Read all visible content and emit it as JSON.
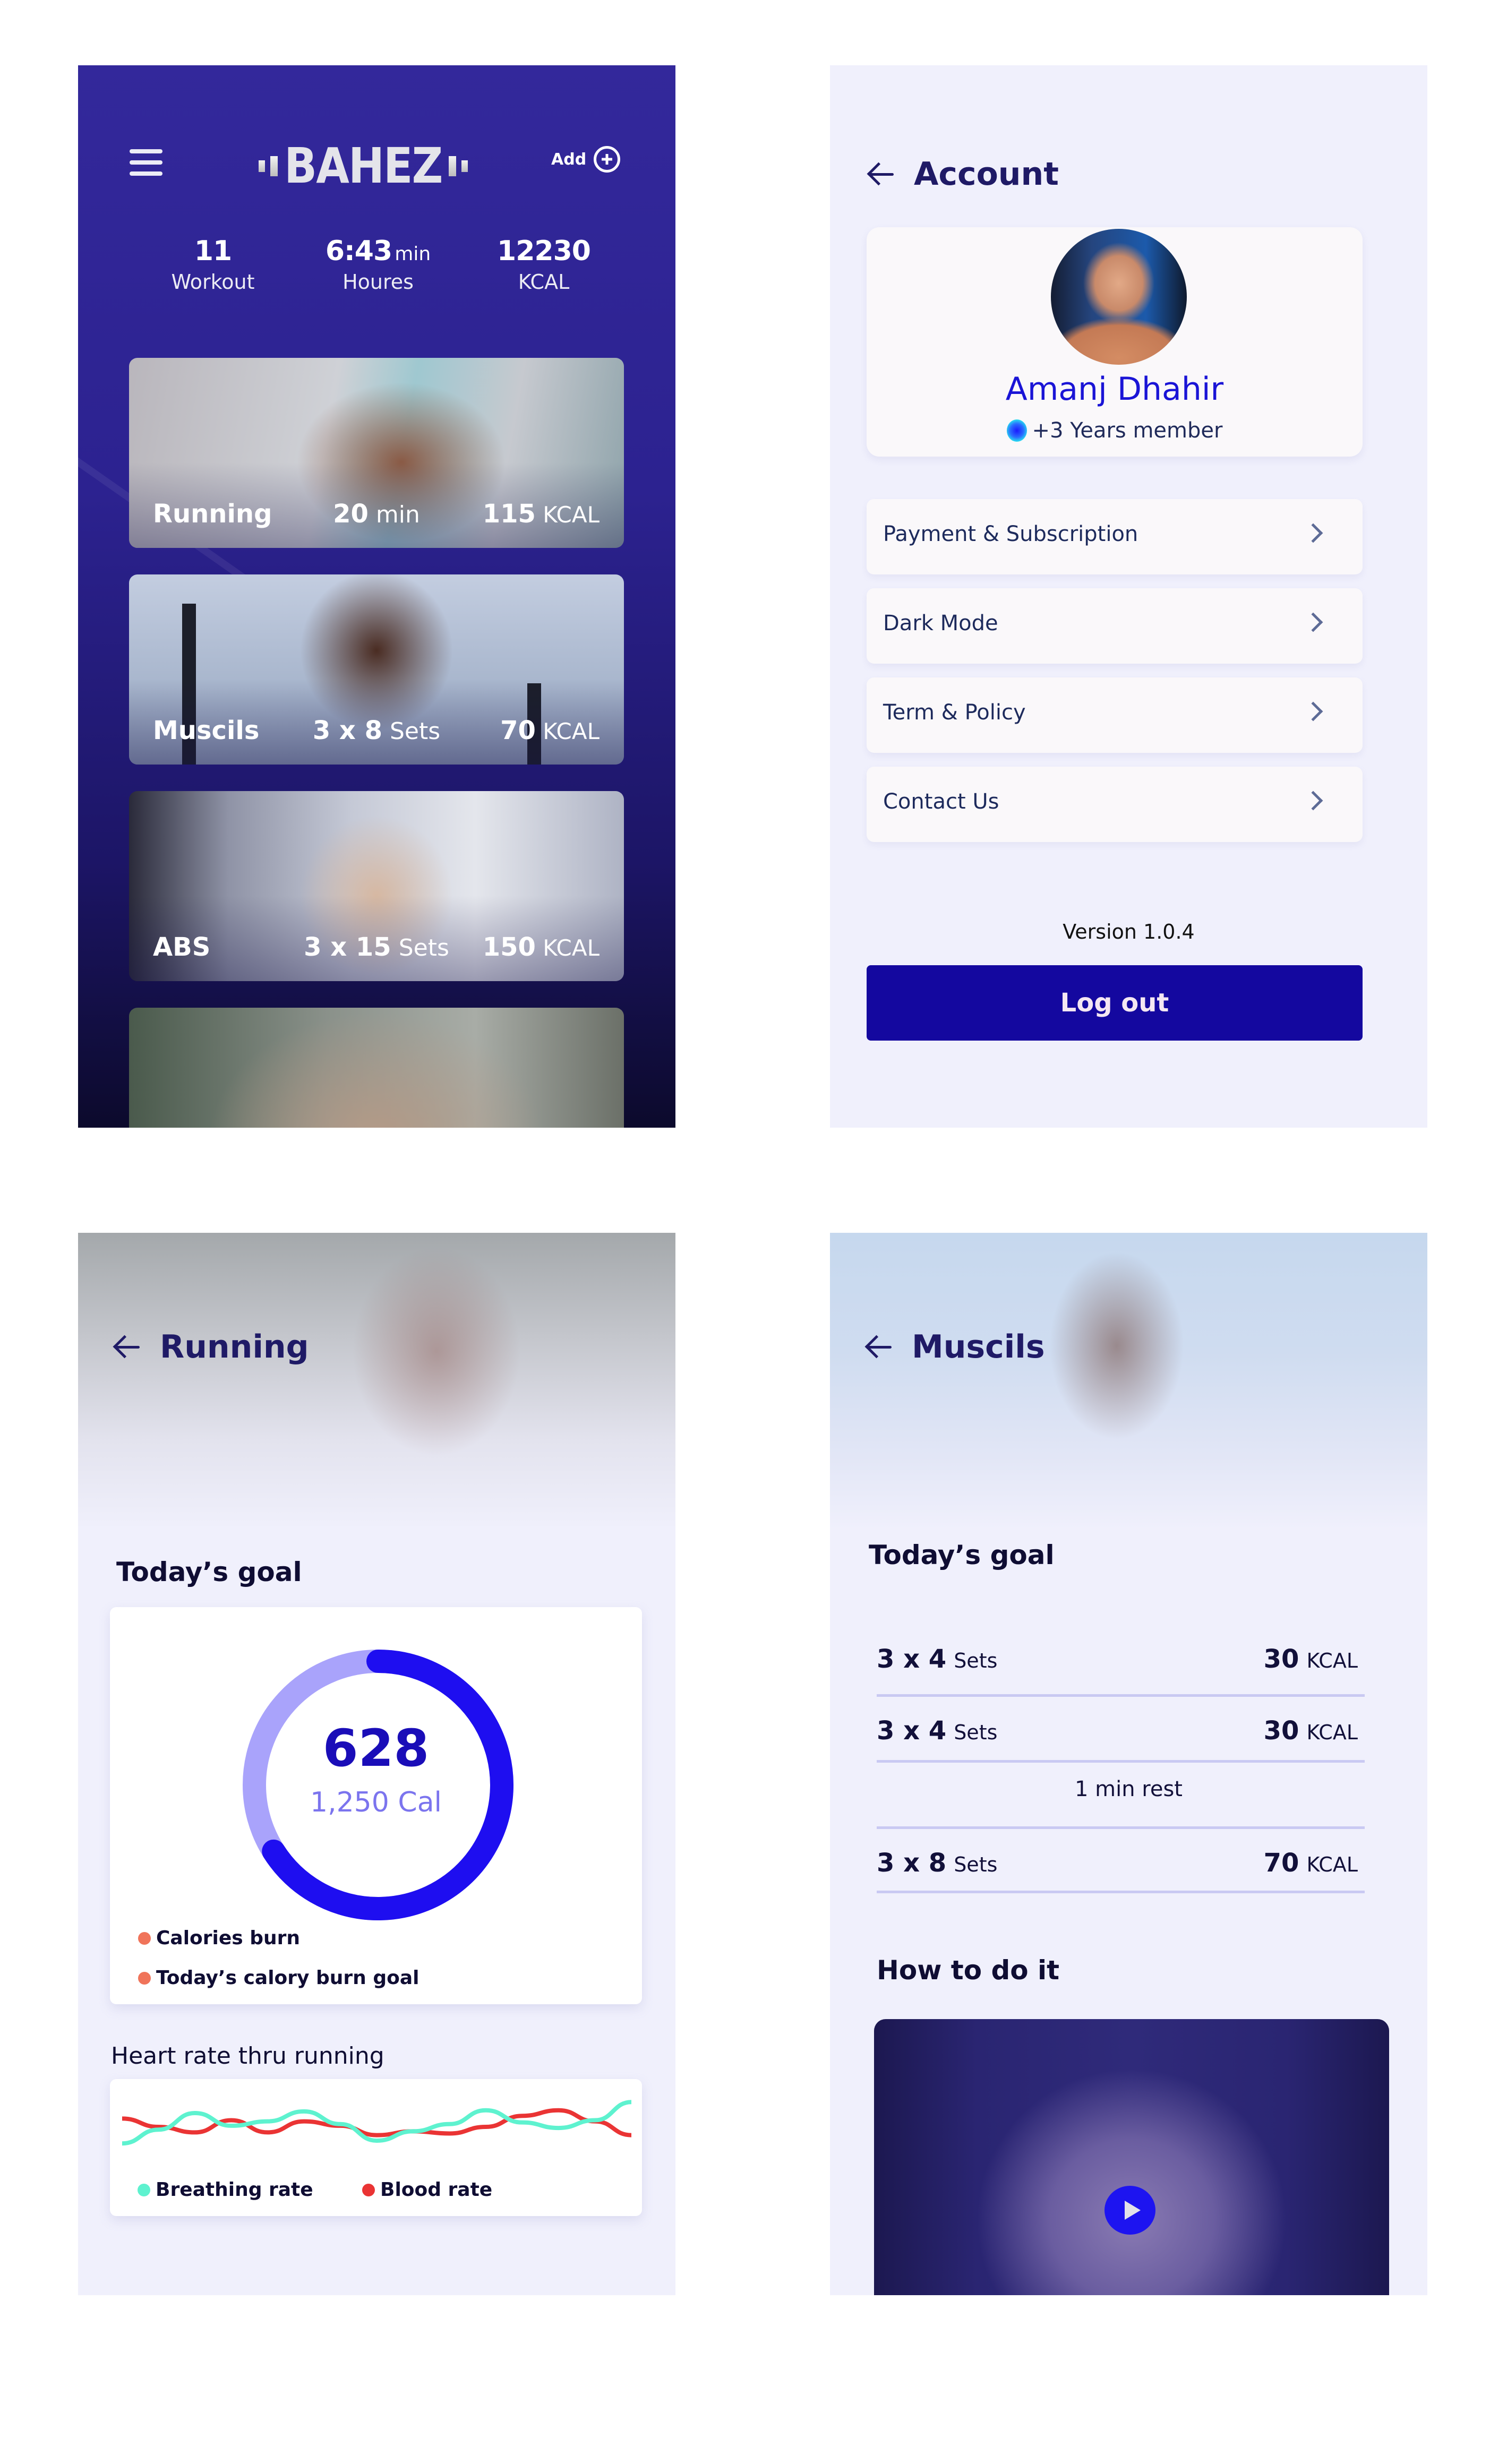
{
  "home": {
    "logo": "BAHEZ",
    "add_label": "Add",
    "stats": [
      {
        "value": "11",
        "unit": "",
        "label": "Workout"
      },
      {
        "value": "6:43",
        "unit": "min",
        "label": "Houres"
      },
      {
        "value": "12230",
        "unit": "",
        "label": "KCAL"
      }
    ],
    "workouts": [
      {
        "name": "Running",
        "amount": "20",
        "amount_unit": "min",
        "kcal": "115",
        "kcal_unit": "KCAL"
      },
      {
        "name": "Muscils",
        "amount": "3 x 8",
        "amount_unit": "Sets",
        "kcal": "70",
        "kcal_unit": "KCAL"
      },
      {
        "name": "ABS",
        "amount": "3 x 15",
        "amount_unit": "Sets",
        "kcal": "150",
        "kcal_unit": "KCAL"
      },
      {
        "name": "",
        "amount": "",
        "amount_unit": "",
        "kcal": "",
        "kcal_unit": ""
      }
    ]
  },
  "account": {
    "title": "Account",
    "name": "Amanj Dhahir",
    "membership": "+3 Years member",
    "menu": [
      {
        "label": "Payment & Subscription"
      },
      {
        "label": "Dark Mode"
      },
      {
        "label": "Term & Policy"
      },
      {
        "label": "Contact Us"
      }
    ],
    "version": "Version 1.0.4",
    "logout_label": "Log out"
  },
  "running": {
    "title": "Running",
    "goal_title": "Today’s goal",
    "burned": "628",
    "goal": "1,250  Cal",
    "legend": [
      "Calories burn",
      "Today’s calory burn goal"
    ],
    "heart_title": "Heart rate thru running",
    "heart_legend": [
      "Breathing rate",
      "Blood rate"
    ]
  },
  "muscils": {
    "title": "Muscils",
    "goal_title": "Today’s goal",
    "sets": [
      {
        "reps": "3 x 4",
        "unit": "Sets",
        "kcal": "30",
        "kcal_unit": "KCAL"
      },
      {
        "reps": "3 x 4",
        "unit": "Sets",
        "kcal": "30",
        "kcal_unit": "KCAL"
      },
      {
        "reps": "3 x 8",
        "unit": "Sets",
        "kcal": "70",
        "kcal_unit": "KCAL"
      }
    ],
    "rest": "1 min rest",
    "how_title": "How to do it"
  },
  "colors": {
    "primary": "#14089f",
    "accent_blue": "#1e0ef0",
    "ring_track": "#a9a3fb",
    "legend_dot": "#f0745a",
    "breathing": "#5ef2cf",
    "blood": "#ea3434",
    "home_bg": "#33289b",
    "screen_bg": "#f0f0fc"
  },
  "chart_data": [
    {
      "type": "pie",
      "title": "Today’s goal",
      "values": {
        "calories_burn": 628,
        "goal": 1250
      },
      "unit": "Cal",
      "legend": [
        "Calories burn",
        "Today’s calory burn goal"
      ],
      "progress_fraction": 0.66
    },
    {
      "type": "line",
      "title": "Heart rate thru running",
      "x": [
        0,
        1,
        2,
        3,
        4,
        5,
        6,
        7,
        8,
        9,
        10,
        11,
        12,
        13,
        14
      ],
      "series": [
        {
          "name": "Breathing rate",
          "values": [
            20,
            45,
            75,
            52,
            60,
            78,
            55,
            25,
            42,
            55,
            80,
            58,
            48,
            62,
            95
          ]
        },
        {
          "name": "Blood rate",
          "values": [
            65,
            50,
            40,
            62,
            40,
            60,
            52,
            35,
            42,
            38,
            50,
            70,
            80,
            60,
            35
          ]
        }
      ],
      "legend": [
        "Breathing rate",
        "Blood rate"
      ],
      "legend_placement": "bottom",
      "axes_visible": false,
      "grid": false
    }
  ]
}
